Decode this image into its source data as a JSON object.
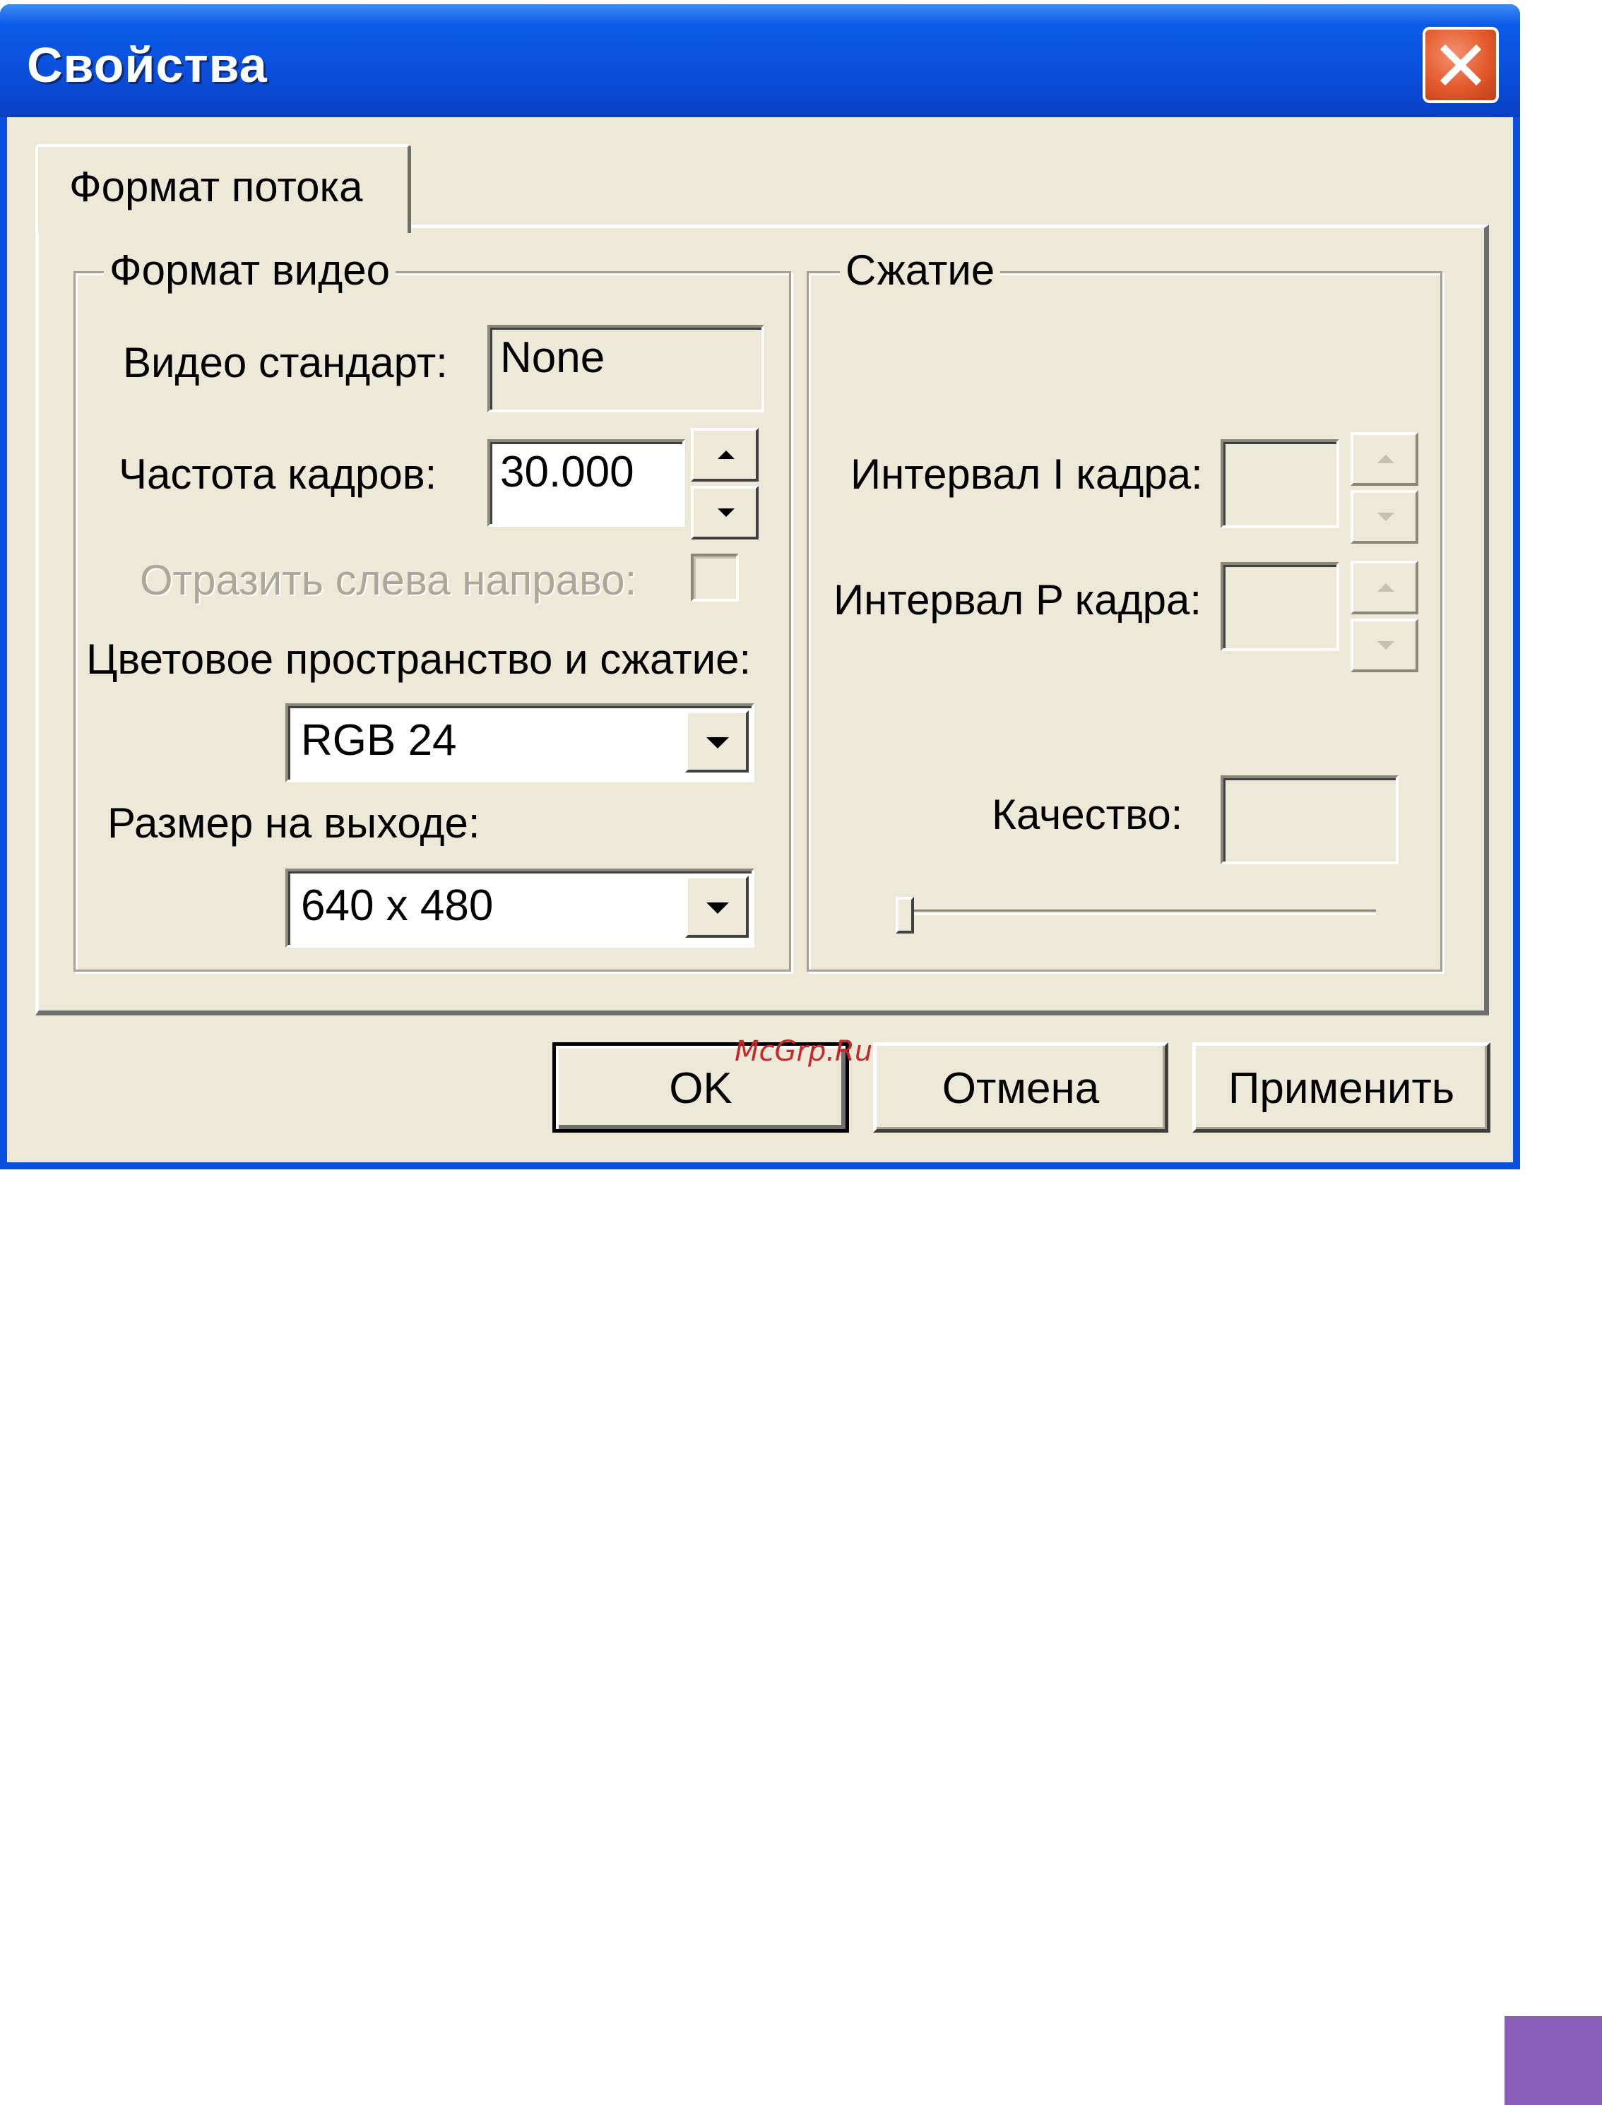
{
  "window": {
    "title": "Свойства"
  },
  "tab": {
    "label": "Формат потока"
  },
  "video_format": {
    "title": "Формат видео",
    "video_standard_label": "Видео стандарт:",
    "video_standard_value": "None",
    "frame_rate_label": "Частота кадров:",
    "frame_rate_value": "30.000",
    "mirror_label": "Отразить слева направо:",
    "mirror_checked": false,
    "color_space_label": "Цветовое пространство и сжатие:",
    "color_space_value": "RGB 24",
    "output_size_label": "Размер на выходе:",
    "output_size_value": "640 x 480"
  },
  "compression": {
    "title": "Сжатие",
    "i_frame_label": "Интервал I кадра:",
    "i_frame_value": "",
    "p_frame_label": "Интервал P кадра:",
    "p_frame_value": "",
    "quality_label": "Качество:",
    "quality_value": "",
    "quality_slider_level": 0
  },
  "buttons": {
    "ok": "OK",
    "cancel": "Отмена",
    "apply": "Применить"
  },
  "watermark": "McGrp.Ru",
  "colors": {
    "titlebar": "#0a4fdc",
    "face": "#ece9d8",
    "close": "#e35a2c",
    "corner": "#8b60b8"
  }
}
